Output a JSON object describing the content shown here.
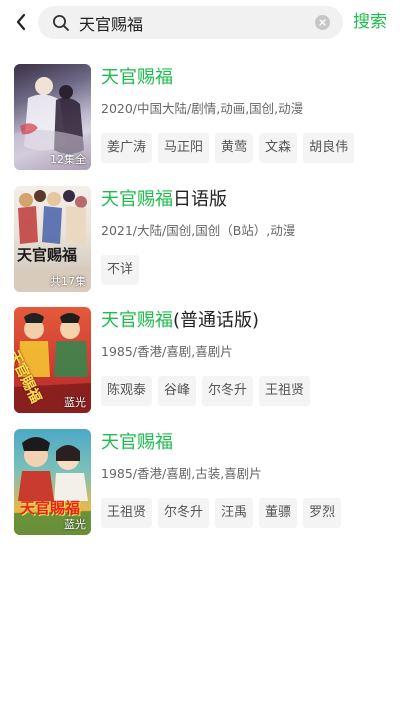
{
  "search": {
    "query": "天官赐福",
    "button_label": "搜索"
  },
  "results": [
    {
      "title_highlight": "天官赐福",
      "title_rest": "",
      "meta": "2020/中国大陆/剧情,动画,国创,动漫",
      "badge": "12集全",
      "tags": [
        "姜广涛",
        "马正阳",
        "黄莺",
        "文森",
        "胡良伟"
      ]
    },
    {
      "title_highlight": "天官赐福",
      "title_rest": "日语版",
      "meta": "2021/大陆/国创,国创（B站）,动漫",
      "badge": "共17集",
      "poster_text": "天官赐福",
      "tags": [
        "不详"
      ]
    },
    {
      "title_highlight": "天官赐福",
      "title_rest": "(普通话版)",
      "meta": "1985/香港/喜剧,喜剧片",
      "badge": "蓝光",
      "poster_text": "天官賜福",
      "tags": [
        "陈观泰",
        "谷峰",
        "尔冬升",
        "王祖贤"
      ]
    },
    {
      "title_highlight": "天官赐福",
      "title_rest": "",
      "meta": "1985/香港/喜剧,古装,喜剧片",
      "badge": "蓝光",
      "poster_text": "天官賜福",
      "tags": [
        "王祖贤",
        "尔冬升",
        "汪禹",
        "董骠",
        "罗烈"
      ]
    }
  ],
  "colors": {
    "accent": "#1dbd4c"
  }
}
